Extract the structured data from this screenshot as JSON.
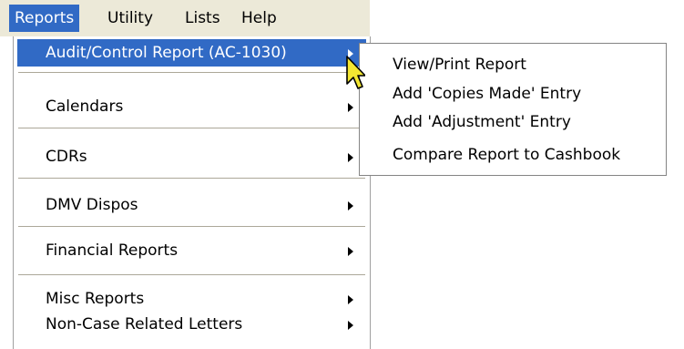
{
  "menubar": {
    "items": [
      {
        "label": "Reports"
      },
      {
        "label": "Utility"
      },
      {
        "label": "Lists"
      },
      {
        "label": "Help"
      }
    ]
  },
  "reports_menu": {
    "items": [
      {
        "label": "Audit/Control Report (AC-1030)",
        "has_submenu": true,
        "highlighted": true
      },
      {
        "label": "Calendars",
        "has_submenu": true
      },
      {
        "label": "CDRs",
        "has_submenu": true
      },
      {
        "label": "DMV Dispos",
        "has_submenu": true
      },
      {
        "label": "Financial Reports",
        "has_submenu": true
      },
      {
        "label": "Misc Reports",
        "has_submenu": true
      },
      {
        "label": "Non-Case Related Letters",
        "has_submenu": true
      }
    ]
  },
  "submenu": {
    "items": [
      {
        "label": "View/Print Report"
      },
      {
        "label": "Add 'Copies Made' Entry"
      },
      {
        "label": "Add 'Adjustment' Entry"
      },
      {
        "label": "Compare Report to Cashbook"
      }
    ]
  },
  "colors": {
    "highlight": "#316ac5",
    "menubar_background": "#ece9d8",
    "cursor_fill": "#f3e632"
  },
  "icons": {
    "cursor": "mouse-pointer-icon",
    "submenu_indicator": "submenu-arrow-icon"
  }
}
